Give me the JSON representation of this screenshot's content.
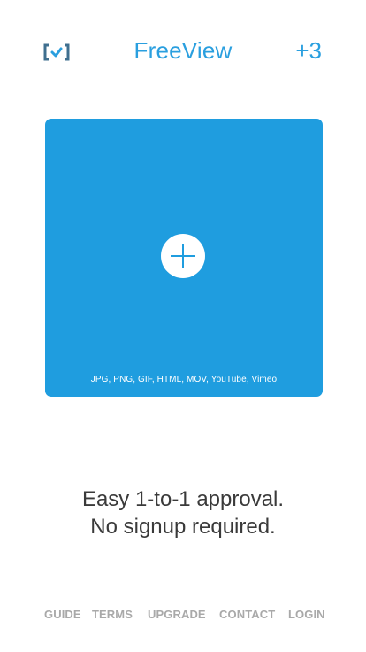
{
  "header": {
    "title": "FreeView",
    "badge": "+3",
    "logo_icon": "bracket-check-icon"
  },
  "upload": {
    "add_icon": "plus-icon",
    "formats": "JPG, PNG, GIF, HTML, MOV, YouTube, Vimeo"
  },
  "tagline": {
    "line1": "Easy 1-to-1 approval.",
    "line2": "No signup required."
  },
  "footer": {
    "guide": "GUIDE",
    "terms": "TERMS",
    "upgrade": "UPGRADE",
    "contact": "CONTACT",
    "login": "LOGIN"
  },
  "colors": {
    "accent": "#1f9ddf",
    "title": "#2a9fdf",
    "logo": "#3f6f8f",
    "footer_text": "#a9a9a9",
    "body_text": "#3a3a3a"
  }
}
